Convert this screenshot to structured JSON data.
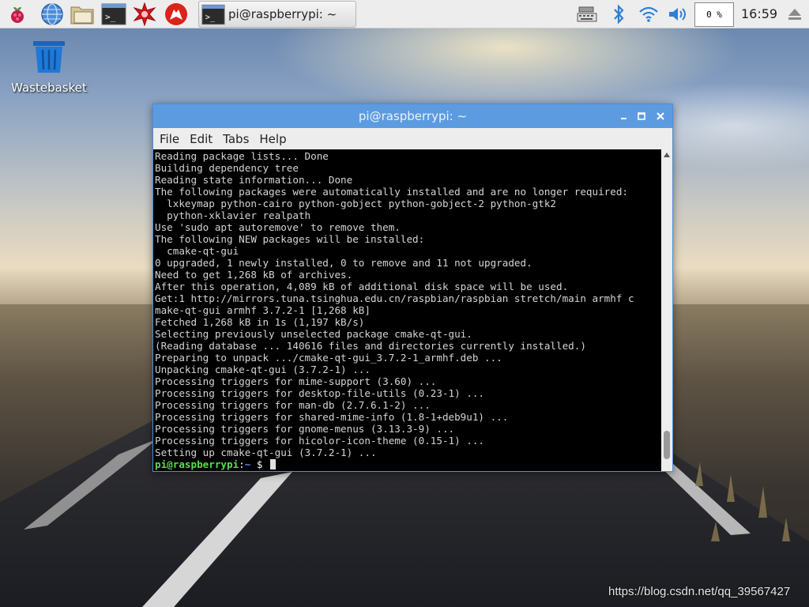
{
  "panel": {
    "launchers": [
      {
        "icon": "raspberry-menu-icon"
      },
      {
        "icon": "web-browser-icon"
      },
      {
        "icon": "file-manager-icon"
      },
      {
        "icon": "terminal-icon"
      },
      {
        "icon": "mathematica-icon"
      },
      {
        "icon": "wolfram-icon"
      }
    ],
    "task_title": "pi@raspberrypi: ~",
    "cpu_label": "0 %",
    "clock": "16:59"
  },
  "desktop": {
    "wastebasket_label": "Wastebasket"
  },
  "window": {
    "title": "pi@raspberrypi: ~",
    "menu": [
      "File",
      "Edit",
      "Tabs",
      "Help"
    ],
    "terminal_lines": [
      "Reading package lists... Done",
      "Building dependency tree",
      "Reading state information... Done",
      "The following packages were automatically installed and are no longer required:",
      "  lxkeymap python-cairo python-gobject python-gobject-2 python-gtk2",
      "  python-xklavier realpath",
      "Use 'sudo apt autoremove' to remove them.",
      "The following NEW packages will be installed:",
      "  cmake-qt-gui",
      "0 upgraded, 1 newly installed, 0 to remove and 11 not upgraded.",
      "Need to get 1,268 kB of archives.",
      "After this operation, 4,089 kB of additional disk space will be used.",
      "Get:1 http://mirrors.tuna.tsinghua.edu.cn/raspbian/raspbian stretch/main armhf c",
      "make-qt-gui armhf 3.7.2-1 [1,268 kB]",
      "Fetched 1,268 kB in 1s (1,197 kB/s)",
      "Selecting previously unselected package cmake-qt-gui.",
      "(Reading database ... 140616 files and directories currently installed.)",
      "Preparing to unpack .../cmake-qt-gui_3.7.2-1_armhf.deb ...",
      "Unpacking cmake-qt-gui (3.7.2-1) ...",
      "Processing triggers for mime-support (3.60) ...",
      "Processing triggers for desktop-file-utils (0.23-1) ...",
      "Processing triggers for man-db (2.7.6.1-2) ...",
      "Processing triggers for shared-mime-info (1.8-1+deb9u1) ...",
      "Processing triggers for gnome-menus (3.13.3-9) ...",
      "Processing triggers for hicolor-icon-theme (0.15-1) ...",
      "Setting up cmake-qt-gui (3.7.2-1) ..."
    ],
    "prompt": {
      "user_host": "pi@raspberrypi",
      "sep": ":",
      "path": "~",
      "dollar": " $ "
    }
  },
  "watermark": "https://blog.csdn.net/qq_39567427"
}
